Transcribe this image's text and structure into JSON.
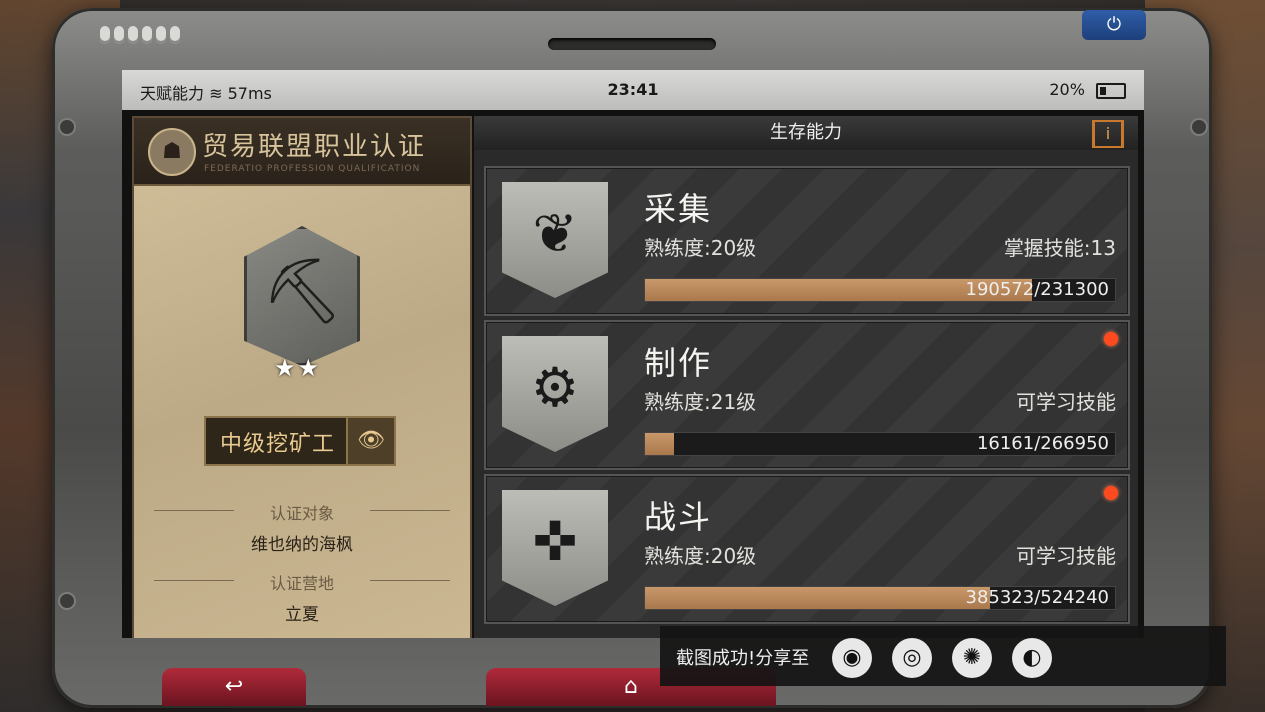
{
  "statusbar": {
    "talent": "天赋能力",
    "ping": "57ms",
    "time": "23:41",
    "battery": "20%"
  },
  "left_panel": {
    "title": "贸易联盟职业认证",
    "subtitle": "FEDERATIO PROFESSION QUALIFICATION",
    "rank": "中级挖矿工",
    "stars": "★★",
    "target_label": "认证对象",
    "target_value": "维也纳的海枫",
    "camp_label": "认证营地",
    "camp_value": "立夏"
  },
  "right_panel": {
    "title": "生存能力",
    "info_icon": "i",
    "skills": [
      {
        "name": "采集",
        "level": "熟练度:20级",
        "right_text": "掌握技能:13",
        "progress_text": "190572/231300",
        "progress": 0.824,
        "icon": "leaf-icon",
        "has_dot": false
      },
      {
        "name": "制作",
        "level": "熟练度:21级",
        "right_text": "可学习技能",
        "progress_text": "16161/266950",
        "progress": 0.061,
        "icon": "gear-hammer-icon",
        "has_dot": true
      },
      {
        "name": "战斗",
        "level": "熟练度:20级",
        "right_text": "可学习技能",
        "progress_text": "385323/524240",
        "progress": 0.735,
        "icon": "gun-icon",
        "has_dot": true
      }
    ]
  },
  "toast": {
    "text": "截图成功!分享至"
  },
  "colors": {
    "progress": "#b8865a",
    "accent": "#e9a04a",
    "notify": "#ff4a1f"
  }
}
